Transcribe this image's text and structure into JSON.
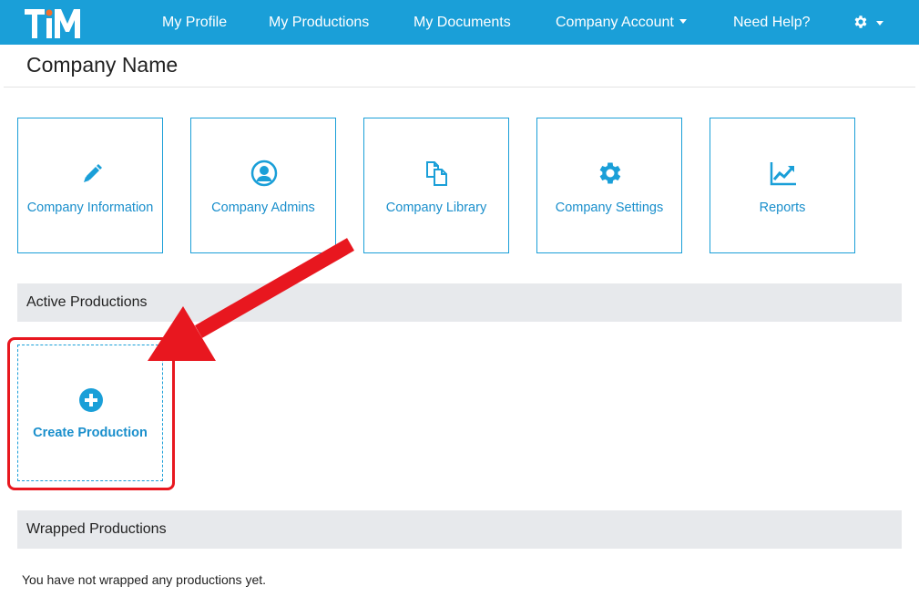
{
  "nav": {
    "logo_text": "TiM",
    "items": [
      {
        "label": "My Profile"
      },
      {
        "label": "My Productions"
      },
      {
        "label": "My Documents"
      },
      {
        "label": "Company Account"
      },
      {
        "label": "Need Help?"
      }
    ],
    "settings_icon": "gear-icon"
  },
  "page": {
    "title": "Company Name"
  },
  "tiles": [
    {
      "label": "Company Information",
      "icon": "pencil-icon"
    },
    {
      "label": "Company Admins",
      "icon": "user-circle-icon"
    },
    {
      "label": "Company Library",
      "icon": "copy-documents-icon"
    },
    {
      "label": "Company Settings",
      "icon": "gear-icon"
    },
    {
      "label": "Reports",
      "icon": "line-chart-icon"
    }
  ],
  "active_section": {
    "title": "Active Productions",
    "create_label": "Create Production",
    "create_icon": "plus-circle-icon"
  },
  "wrapped_section": {
    "title": "Wrapped Productions",
    "empty_message": "You have not wrapped any productions yet."
  },
  "colors": {
    "brand_blue": "#1a9fd8",
    "link_blue": "#1a8fcc",
    "annotation_red": "#e8171f",
    "section_bg": "#e7e9ec"
  }
}
